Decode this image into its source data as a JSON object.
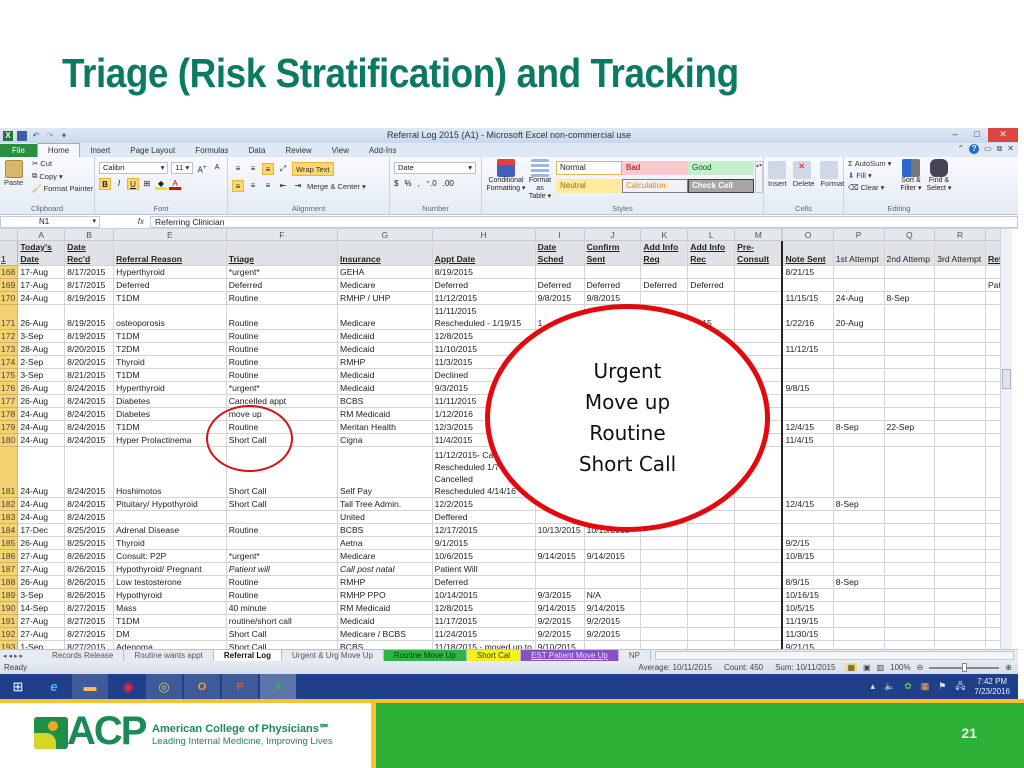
{
  "slide": {
    "title": "Triage (Risk Stratification) and Tracking",
    "page_number": "21",
    "logo": {
      "letters": "ACP",
      "name": "American College of Physicians℠",
      "tagline": "Leading Internal Medicine, Improving Lives"
    }
  },
  "window": {
    "title": "Referral Log 2015 (A1)  -  Microsoft Excel non-commercial use",
    "controls": {
      "minimize": "–",
      "maximize": "□",
      "close": "✕"
    }
  },
  "ribbon": {
    "tabs": [
      "File",
      "Home",
      "Insert",
      "Page Layout",
      "Formulas",
      "Data",
      "Review",
      "View",
      "Add-Ins"
    ],
    "active_tab": "Home",
    "clipboard": {
      "paste": "Paste",
      "cut": "Cut",
      "copy": "Copy ▾",
      "format_painter": "Format Painter",
      "label": "Clipboard"
    },
    "font": {
      "name": "Calibri",
      "size": "11",
      "bold": "B",
      "italic": "I",
      "underline": "U",
      "label": "Font"
    },
    "alignment": {
      "wrap_text": "Wrap Text",
      "merge_center": "Merge & Center ▾",
      "label": "Alignment"
    },
    "number": {
      "format": "Date",
      "currency": "$",
      "percent": "%",
      "comma": ",",
      "label": "Number"
    },
    "styles": {
      "conditional": "Conditional Formatting ▾",
      "format_table": "Format as Table ▾",
      "cells": [
        {
          "label": "Normal",
          "bg": "#ffffff",
          "fg": "#222222",
          "border": "#e8b64a"
        },
        {
          "label": "Bad",
          "bg": "#ffc7ce",
          "fg": "#9c0006",
          "border": "#ffc7ce"
        },
        {
          "label": "Good",
          "bg": "#c6efce",
          "fg": "#006100",
          "border": "#c6efce"
        },
        {
          "label": "Neutral",
          "bg": "#ffeb9c",
          "fg": "#9c6500",
          "border": "#ffeb9c"
        },
        {
          "label": "Calculation",
          "bg": "#f2f2f2",
          "fg": "#fa7d00",
          "border": "#7f7f7f"
        },
        {
          "label": "Check Cell",
          "bg": "#a5a5a5",
          "fg": "#ffffff",
          "border": "#3f3f3f"
        }
      ],
      "label": "Styles"
    },
    "cells": {
      "insert": "Insert",
      "delete": "Delete",
      "format": "Format",
      "label": "Cells"
    },
    "editing": {
      "autosum": "Σ AutoSum ▾",
      "fill": "Fill ▾",
      "clear": "Clear ▾",
      "sort_filter": "Sort & Filter ▾",
      "find_select": "Find & Select ▾",
      "label": "Editing"
    }
  },
  "formula_bar": {
    "name_box": "N1",
    "fx": "fx",
    "value": "Referring Clinician"
  },
  "sheet": {
    "columns": [
      "A",
      "B",
      "E",
      "F",
      "G",
      "H",
      "I",
      "J",
      "K",
      "L",
      "M",
      "O",
      "P",
      "Q",
      "R",
      ""
    ],
    "header_row_num": "1",
    "headers": [
      "Today's Date",
      "Date Rec'd",
      "Referral Reason",
      "Triage",
      "Insurance",
      "Appt Date",
      "Date Sched",
      "Confirm Sent",
      "Add Info Req",
      "Add Info Rec",
      "Pre-Consult",
      "Note Sent",
      "1st Attempt",
      "2nd Attemp",
      "3rd Attempt",
      "Ref"
    ],
    "rows": [
      {
        "n": "168",
        "c": [
          "17-Aug",
          "8/17/2015",
          "Hyperthyroid",
          "*urgent*",
          "GEHA",
          "8/19/2015",
          "",
          "",
          "",
          "",
          "",
          "8/21/15",
          "",
          "",
          "",
          ""
        ]
      },
      {
        "n": "169",
        "c": [
          "17-Aug",
          "8/17/2015",
          "Deferred",
          "Deferred",
          "Medicare",
          "Deferred",
          "Deferred",
          "Deferred",
          "Deferred",
          "Deferred",
          "",
          "",
          "",
          "",
          "",
          "Pat"
        ]
      },
      {
        "n": "170",
        "c": [
          "24-Aug",
          "8/19/2015",
          "T1DM",
          "Routine",
          "RMHP / UHP",
          "11/12/2015",
          "9/8/2015",
          "9/8/2015",
          "",
          "",
          "",
          "11/15/15",
          "24-Aug",
          "8-Sep",
          "",
          ""
        ]
      },
      {
        "n": "171",
        "tall": true,
        "h_extra": "11/11/2015",
        "c": [
          "26-Aug",
          "8/19/2015",
          "osteoporosis",
          "Routine",
          "Medicare",
          "Rescheduled - 1/19/15",
          "1",
          "",
          "",
          "/2015",
          "",
          "1/22/16",
          "20-Aug",
          "",
          "",
          ""
        ]
      },
      {
        "n": "172",
        "c": [
          "3-Sep",
          "8/19/2015",
          "T1DM",
          "Routine",
          "Medicaid",
          "12/8/2015",
          "",
          "",
          "",
          "",
          "",
          "",
          "",
          "",
          "",
          ""
        ]
      },
      {
        "n": "173",
        "c": [
          "28-Aug",
          "8/20/2015",
          "T2DM",
          "Routine",
          "Medicaid",
          "11/10/2015",
          "",
          "",
          "",
          "",
          "",
          "11/12/15",
          "",
          "",
          "",
          ""
        ]
      },
      {
        "n": "174",
        "c": [
          "2-Sep",
          "8/20/2015",
          "Thyroid",
          "Routine",
          "RMHP",
          "11/3/2015",
          "",
          "",
          "",
          "",
          "",
          "",
          "",
          "",
          "",
          ""
        ]
      },
      {
        "n": "175",
        "c": [
          "3-Sep",
          "8/21/2015",
          "T1DM",
          "Routine",
          "Medicaid",
          "Declined",
          "",
          "",
          "",
          "",
          "",
          "",
          "",
          "",
          "",
          ""
        ]
      },
      {
        "n": "176",
        "c": [
          "26-Aug",
          "8/24/2015",
          "Hyperthyroid",
          "*urgent*",
          "Medicaid",
          "9/3/2015",
          "",
          "",
          "",
          "",
          "",
          "9/8/15",
          "",
          "",
          "",
          ""
        ]
      },
      {
        "n": "177",
        "c": [
          "26-Aug",
          "8/24/2015",
          "Diabetes",
          "Cancelled appt",
          "BCBS",
          "11/11/2015",
          "",
          "",
          "",
          "",
          "",
          "",
          "",
          "",
          "",
          ""
        ]
      },
      {
        "n": "178",
        "c": [
          "24-Aug",
          "8/24/2015",
          "Diabetes",
          "move up",
          "RM Medicaid",
          "1/12/2016",
          "",
          "",
          "",
          "",
          "",
          "",
          "",
          "",
          "",
          ""
        ]
      },
      {
        "n": "179",
        "c": [
          "24-Aug",
          "8/24/2015",
          "T1DM",
          "Routine",
          "Meritan Health",
          "12/3/2015",
          "",
          "",
          "",
          "",
          "",
          "12/4/15",
          "8-Sep",
          "22-Sep",
          "",
          ""
        ]
      },
      {
        "n": "180",
        "c": [
          "24-Aug",
          "8/24/2015",
          "Hyper Prolactinema",
          "Short Call",
          "Cigna",
          "11/4/2015",
          "",
          "",
          "",
          "",
          "",
          "11/4/15",
          "",
          "",
          "",
          ""
        ]
      },
      {
        "n": "181",
        "xtall": true,
        "h_lines": [
          "11/12/2015- Ca",
          "Rescheduled 1/7",
          "Cancelled"
        ],
        "c": [
          "24-Aug",
          "8/24/2015",
          "Hoshimotos",
          "Short Call",
          "Self Pay",
          "Rescheduled 4/14/16",
          "",
          "",
          "",
          "",
          "",
          "",
          "",
          "",
          "",
          ""
        ]
      },
      {
        "n": "182",
        "c": [
          "24-Aug",
          "8/24/2015",
          "Pituitary/ Hypothyroid",
          "Short Call",
          "Tall Tree Admin.",
          "12/2/2015",
          "",
          "",
          "",
          "",
          "",
          "12/4/15",
          "8-Sep",
          "",
          "",
          ""
        ]
      },
      {
        "n": "183",
        "c": [
          "24-Aug",
          "8/24/2015",
          "",
          "",
          "United",
          "Deffered",
          "",
          "",
          "",
          "",
          "",
          "",
          "",
          "",
          "",
          ""
        ]
      },
      {
        "n": "184",
        "c": [
          "17-Dec",
          "8/25/2015",
          "Adrenal Disease",
          "Routine",
          "BCBS",
          "12/17/2015",
          "10/13/2015",
          "10/13/2015",
          "",
          "",
          "",
          "",
          "",
          "",
          "",
          ""
        ]
      },
      {
        "n": "185",
        "c": [
          "26-Aug",
          "8/25/2015",
          "Thyroid",
          "",
          "Aetna",
          "9/1/2015",
          "",
          "",
          "",
          "",
          "",
          "9/2/15",
          "",
          "",
          "",
          ""
        ]
      },
      {
        "n": "186",
        "c": [
          "27-Aug",
          "8/26/2015",
          "Consult: P2P",
          "*urgent*",
          "Medicare",
          "10/6/2015",
          "9/14/2015",
          "9/14/2015",
          "",
          "",
          "",
          "10/8/15",
          "",
          "",
          "",
          ""
        ]
      },
      {
        "n": "187",
        "italic": [
          3,
          4
        ],
        "c": [
          "27-Aug",
          "8/26/2015",
          "Hypothyroid/ Pregnant",
          "Patient will",
          "Call post natal",
          "Patient Will",
          "",
          "",
          "",
          "",
          "",
          "",
          "",
          "",
          "",
          ""
        ]
      },
      {
        "n": "188",
        "c": [
          "26-Aug",
          "8/26/2015",
          "Low testosterone",
          "Routine",
          "RMHP",
          "Deferred",
          "",
          "",
          "",
          "",
          "",
          "8/9/15",
          "8-Sep",
          "",
          "",
          ""
        ]
      },
      {
        "n": "189",
        "c": [
          "3-Sep",
          "8/26/2015",
          "Hypothyroid",
          "Routine",
          "RMHP PPO",
          "10/14/2015",
          "9/3/2015",
          "N/A",
          "",
          "",
          "",
          "10/16/15",
          "",
          "",
          "",
          ""
        ]
      },
      {
        "n": "190",
        "c": [
          "14-Sep",
          "8/27/2015",
          "Mass",
          "40 minute",
          "RM Medicaid",
          "12/8/2015",
          "9/14/2015",
          "9/14/2015",
          "",
          "",
          "",
          "10/5/15",
          "",
          "",
          "",
          ""
        ]
      },
      {
        "n": "191",
        "c": [
          "27-Aug",
          "8/27/2015",
          "T1DM",
          "routine/short call",
          "Medicaid",
          "11/17/2015",
          "9/2/2015",
          "9/2/2015",
          "",
          "",
          "",
          "11/19/15",
          "",
          "",
          "",
          ""
        ]
      },
      {
        "n": "192",
        "c": [
          "27-Aug",
          "8/27/2015",
          "DM",
          "Short Call",
          "Medicare / BCBS",
          "11/24/2015",
          "9/2/2015",
          "9/2/2015",
          "",
          "",
          "",
          "11/30/15",
          "",
          "",
          "",
          ""
        ]
      },
      {
        "n": "193",
        "c": [
          "1-Sep",
          "8/27/2015",
          "Adenoma",
          "Short Call",
          "BCBS",
          "11/18/2015 - moved up to",
          "9/10/2015",
          "",
          "",
          "",
          "",
          "9/21/15",
          "",
          "",
          "",
          ""
        ]
      }
    ]
  },
  "sheet_tabs": [
    {
      "label": "Records Release",
      "style": ""
    },
    {
      "label": "Routine wants appt",
      "style": ""
    },
    {
      "label": "Referral Log",
      "style": "active"
    },
    {
      "label": "Urgent & Urg Move Up",
      "style": ""
    },
    {
      "label": "Routine Move Up",
      "style": "green"
    },
    {
      "label": "Short Cal",
      "style": "yellow"
    },
    {
      "label": "EST Patient Move Up",
      "style": "purple"
    },
    {
      "label": "NP",
      "style": ""
    }
  ],
  "status": {
    "ready": "Ready",
    "average": "Average: 10/11/2015",
    "count": "Count: 450",
    "sum": "Sum: 10/11/2015",
    "zoom": "100%"
  },
  "taskbar": {
    "apps": [
      "windows-start",
      "internet-explorer",
      "file-explorer",
      "chrome",
      "cw-app",
      "outlook",
      "powerpoint",
      "excel"
    ],
    "time": "7:42 PM",
    "date": "7/23/2016"
  },
  "annotation": {
    "lines": [
      "Urgent",
      "Move up",
      "Routine",
      "Short Call"
    ],
    "color": "#e3090c"
  }
}
